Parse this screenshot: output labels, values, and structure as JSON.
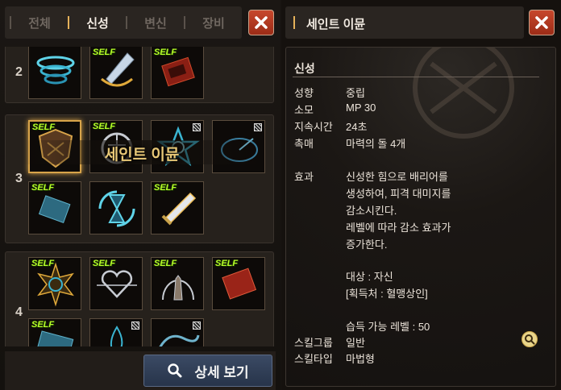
{
  "tabs": [
    {
      "label": "전체"
    },
    {
      "label": "신성"
    },
    {
      "label": "변신"
    },
    {
      "label": "장비"
    }
  ],
  "active_tab": "신성",
  "skill_rows": [
    {
      "level": "2"
    },
    {
      "level": "3"
    },
    {
      "level": "4"
    }
  ],
  "self_tag": "SELF",
  "selected_skill_name": "세인트 이뮨",
  "detail_button_label": "상세 보기",
  "detail": {
    "title": "세인트 이뮨",
    "category": "신성",
    "attributes": [
      {
        "label": "성향",
        "value": "중립"
      },
      {
        "label": "소모",
        "value": "MP 30"
      },
      {
        "label": "지속시간",
        "value": "24초"
      },
      {
        "label": "촉매",
        "value": "마력의 돌 4개"
      }
    ],
    "effect_label": "효과",
    "effect_lines": [
      "신성한 힘으로 배리어를",
      "생성하여, 피격 대미지를",
      "감소시킨다.",
      "레벨에 따라 감소 효과가",
      "증가한다."
    ],
    "target_line": "대상 : 자신",
    "acquire_line": "[획득처 : 혈맹상인]",
    "learn_level_line": "습득 가능 레벨 : 50",
    "skill_group": {
      "label": "스킬그룹",
      "value": "일반"
    },
    "skill_type": {
      "label": "스킬타입",
      "value": "마법형"
    }
  },
  "colors": {
    "accent": "#e5b15a",
    "self_tag": "#b9ff2a",
    "close_button": "#c7472c",
    "detail_button": "#2f3d56"
  },
  "icons": [
    "close-icon",
    "search-icon",
    "zoom-icon"
  ]
}
